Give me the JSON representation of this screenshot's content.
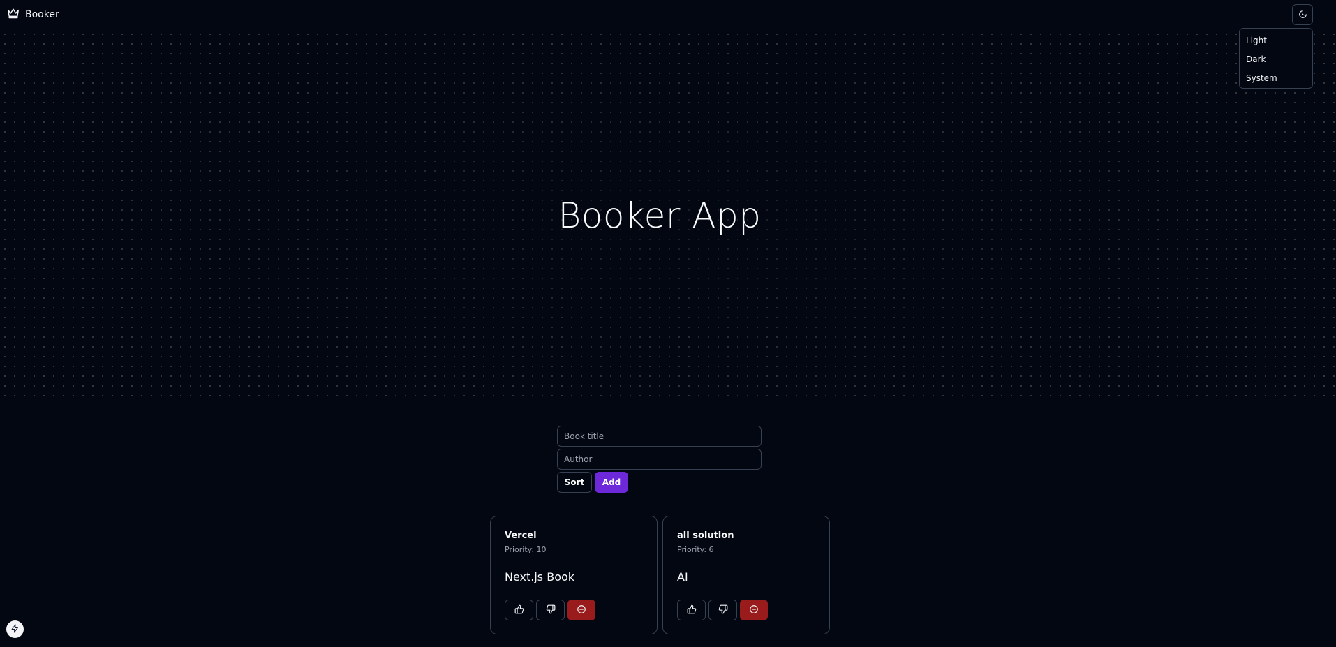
{
  "header": {
    "brand": "Booker",
    "brand_icon": "crown-icon",
    "theme_toggle_icon": "moon-icon"
  },
  "theme_menu": {
    "items": [
      "Light",
      "Dark",
      "System"
    ]
  },
  "hero": {
    "title": "Booker App"
  },
  "form": {
    "title_placeholder": "Book title",
    "author_placeholder": "Author",
    "sort_label": "Sort",
    "add_label": "Add"
  },
  "books": [
    {
      "author": "Vercel",
      "priority": "Priority: 10",
      "title": "Next.js Book"
    },
    {
      "author": "all solution",
      "priority": "Priority: 6",
      "title": "AI"
    }
  ],
  "colors": {
    "background": "#030712",
    "accent": "#6d28d9",
    "danger": "#991b1b",
    "border": "#374151"
  }
}
